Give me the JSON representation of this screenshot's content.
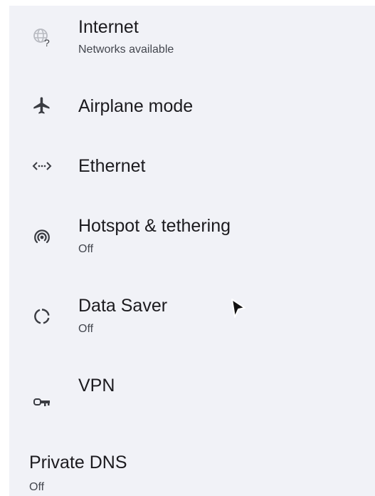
{
  "settings": {
    "items": [
      {
        "id": "internet",
        "icon": "globe-question-icon",
        "title": "Internet",
        "summary": "Networks available"
      },
      {
        "id": "airplane",
        "icon": "airplane-icon",
        "title": "Airplane mode",
        "summary": ""
      },
      {
        "id": "ethernet",
        "icon": "ethernet-icon",
        "title": "Ethernet",
        "summary": ""
      },
      {
        "id": "hotspot",
        "icon": "hotspot-icon",
        "title": "Hotspot & tethering",
        "summary": "Off"
      },
      {
        "id": "datasaver",
        "icon": "data-saver-icon",
        "title": "Data Saver",
        "summary": "Off"
      },
      {
        "id": "vpn",
        "icon": "key-icon",
        "title": "VPN",
        "summary": ""
      },
      {
        "id": "privatedns",
        "icon": "",
        "title": "Private DNS",
        "summary": "Off"
      }
    ]
  },
  "colors": {
    "background": "#f1f2f7",
    "text_primary": "#1c1b1f",
    "text_secondary": "#44474f",
    "icon": "#3a3c42"
  }
}
